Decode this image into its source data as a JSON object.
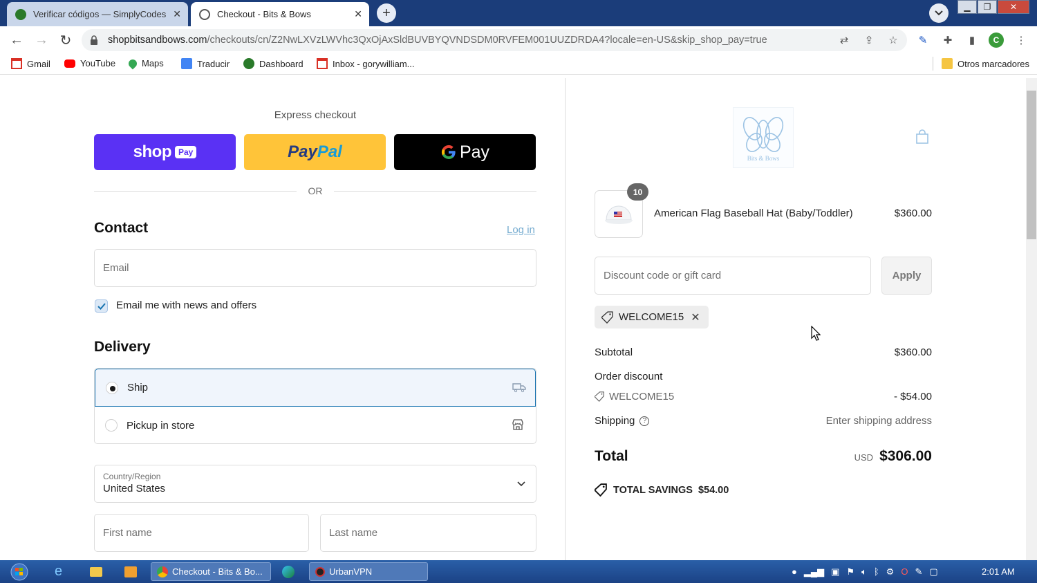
{
  "browser": {
    "tabs": [
      {
        "title": "Verificar códigos — SimplyCodes",
        "active": false
      },
      {
        "title": "Checkout - Bits & Bows",
        "active": true
      }
    ],
    "url_host": "shopbitsandbows.com",
    "url_rest": "/checkouts/cn/Z2NwLXVzLWVhc3QxOjAxSldBUVBYQVNDSDM0RVFEM001UUZDRDA4?locale=en-US&skip_shop_pay=true",
    "profile_initial": "C",
    "bookmarks": [
      "Gmail",
      "YouTube",
      "Maps",
      "Traducir",
      "Dashboard",
      "Inbox - gorywilliam...",
      "Otros marcadores"
    ]
  },
  "checkout": {
    "express_label": "Express checkout",
    "shop_pay": {
      "text": "shop",
      "badge": "Pay"
    },
    "paypal": {
      "part1": "Pay",
      "part2": "Pal"
    },
    "gpay": {
      "text": "Pay"
    },
    "or_label": "OR",
    "contact_heading": "Contact",
    "login_link": "Log in",
    "email_placeholder": "Email",
    "newsletter_label": "Email me with news and offers",
    "newsletter_checked": true,
    "delivery_heading": "Delivery",
    "ship_label": "Ship",
    "pickup_label": "Pickup in store",
    "country_label": "Country/Region",
    "country_value": "United States",
    "first_name_placeholder": "First name",
    "last_name_placeholder": "Last name"
  },
  "summary": {
    "logo_text": "Bits & Bows",
    "product": {
      "qty": "10",
      "name": "American Flag Baseball Hat (Baby/Toddler)",
      "price": "$360.00"
    },
    "discount_placeholder": "Discount code or gift card",
    "apply_label": "Apply",
    "applied_code": "WELCOME15",
    "subtotal_label": "Subtotal",
    "subtotal_value": "$360.00",
    "order_discount_label": "Order discount",
    "discount_code": "WELCOME15",
    "discount_value": "- $54.00",
    "shipping_label": "Shipping",
    "shipping_value": "Enter shipping address",
    "total_label": "Total",
    "currency": "USD",
    "total_value": "$306.00",
    "savings_label": "TOTAL SAVINGS",
    "savings_value": "$54.00"
  },
  "taskbar": {
    "chrome_task": "Checkout - Bits & Bo...",
    "vpn_task": "UrbanVPN",
    "time": "2:01 AM"
  },
  "colors": {
    "shop_pay": "#5a31f4",
    "paypal": "#ffc439",
    "gpay": "#000000",
    "accent_link": "#1773b0"
  }
}
